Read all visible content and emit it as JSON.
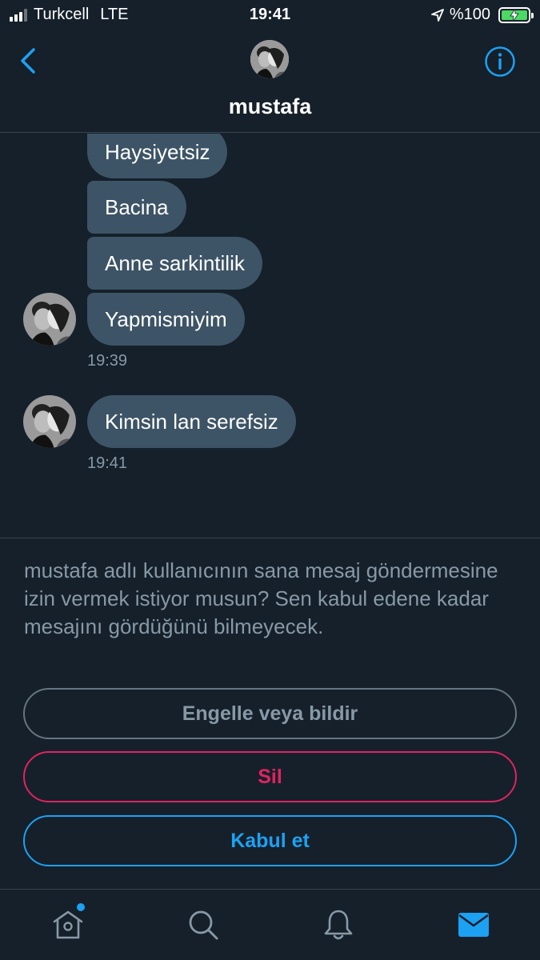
{
  "status_bar": {
    "carrier": "Turkcell",
    "network": "LTE",
    "time": "19:41",
    "battery": "%100"
  },
  "header": {
    "contact_name": "mustafa"
  },
  "messages": [
    {
      "text": "Haysiyetsiz"
    },
    {
      "text": "Bacina"
    },
    {
      "text": "Anne sarkintilik"
    },
    {
      "text": "Yapmismiyim"
    },
    {
      "text": "Kimsin lan serefsiz"
    }
  ],
  "timestamps": {
    "group1": "19:39",
    "group2": "19:41"
  },
  "request": {
    "prompt": "mustafa adlı kullanıcının sana mesaj göndermesine izin vermek istiyor musun? Sen kabul edene kadar mesajını gördüğünü bilmeyecek.",
    "block_label": "Engelle veya bildir",
    "delete_label": "Sil",
    "accept_label": "Kabul et"
  },
  "tabs": [
    {
      "icon": "home-icon"
    },
    {
      "icon": "search-icon"
    },
    {
      "icon": "bell-icon"
    },
    {
      "icon": "mail-icon"
    }
  ],
  "colors": {
    "background": "#15202b",
    "bubble": "#3d5466",
    "accent": "#1da1f2",
    "danger": "#e0245e",
    "muted": "#8899a6"
  }
}
